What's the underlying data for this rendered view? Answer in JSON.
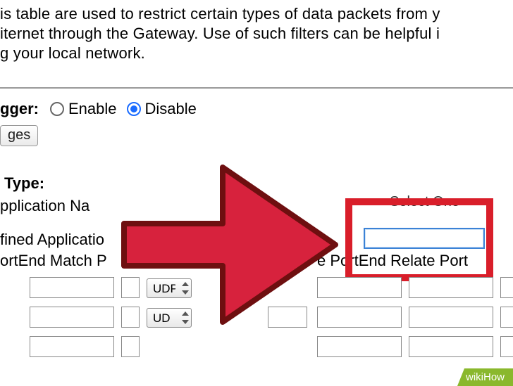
{
  "intro": {
    "line1": "is table are used to restrict certain types of data packets from y",
    "line2": "iternet through the Gateway. Use of such filters can be helpful i",
    "line3": "g your local network."
  },
  "trigger": {
    "label": "gger:",
    "enable": "Enable",
    "disable": "Disable",
    "selected": "disable"
  },
  "ges_button": "ges",
  "type_label": "Type:",
  "labels": {
    "application_na": "pplication Na",
    "fined_applicatio": "fined Applicatio",
    "portend_match": "ortEnd Match P",
    "e_portend_relate": "e PortEnd Relate Port"
  },
  "dropdowns": {
    "select_one_label": "Select One",
    "udp1": "UDP",
    "udp2": "UD"
  },
  "focus_input_value": "",
  "row1": {
    "c0": "",
    "c1": "",
    "c2_proto": "UDP",
    "c3": "",
    "c4": "",
    "c5": ""
  },
  "row2": {
    "c0": "",
    "c1": "",
    "c2_proto": "UD",
    "c3": "",
    "c4": "",
    "c5": ""
  },
  "row3": {
    "c0": "",
    "c1": "",
    "c3": "",
    "c4": "",
    "c5": ""
  },
  "watermark": "wikiHow"
}
